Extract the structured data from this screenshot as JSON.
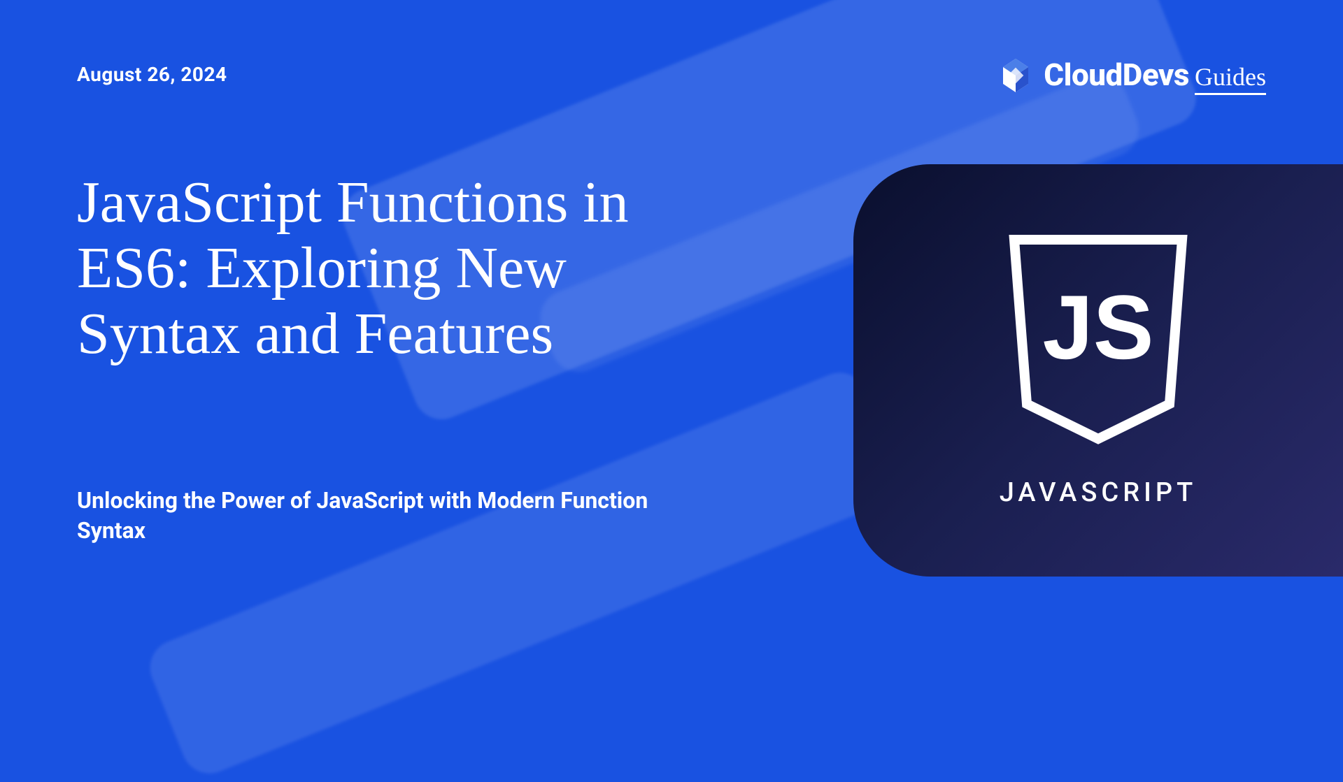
{
  "header": {
    "date": "August 26,  2024",
    "brand": {
      "main": "CloudDevs",
      "sub": "Guides"
    }
  },
  "main": {
    "title": "JavaScript Functions in ES6: Exploring New Syntax and Features",
    "subtitle": "Unlocking the Power of JavaScript with Modern Function Syntax"
  },
  "card": {
    "tech_label": "JAVASCRIPT",
    "shield_text": "JS"
  }
}
